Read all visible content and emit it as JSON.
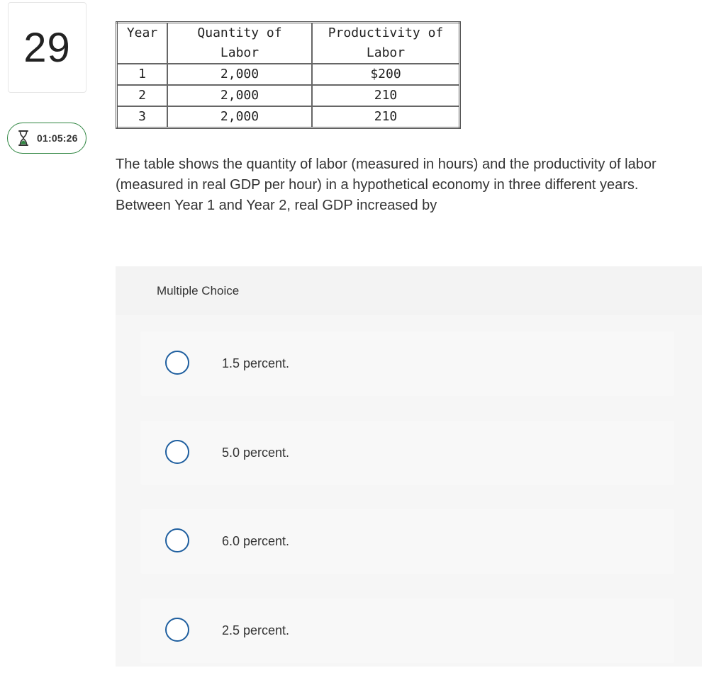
{
  "question": {
    "number": "29",
    "timer": "01:05:26",
    "prompt": "The table shows the quantity of labor (measured in hours) and the productivity of labor (measured in real GDP per hour) in a hypothetical economy in three different years. Between Year 1 and Year 2, real GDP increased by"
  },
  "table": {
    "headers": [
      "Year",
      "Quantity of Labor",
      "Productivity of Labor"
    ],
    "rows": [
      [
        "1",
        "2,000",
        "$200"
      ],
      [
        "2",
        "2,000",
        "210"
      ],
      [
        "3",
        "2,000",
        "210"
      ]
    ]
  },
  "choices": {
    "header": "Multiple Choice",
    "options": [
      {
        "label": "1.5 percent."
      },
      {
        "label": "5.0 percent."
      },
      {
        "label": "6.0 percent."
      },
      {
        "label": "2.5 percent."
      }
    ]
  },
  "colors": {
    "timer_border": "#2e8540",
    "radio_border": "#1f5f9f",
    "panel_bg": "#f6f6f6"
  },
  "icons": {
    "timer": "hourglass-icon"
  }
}
